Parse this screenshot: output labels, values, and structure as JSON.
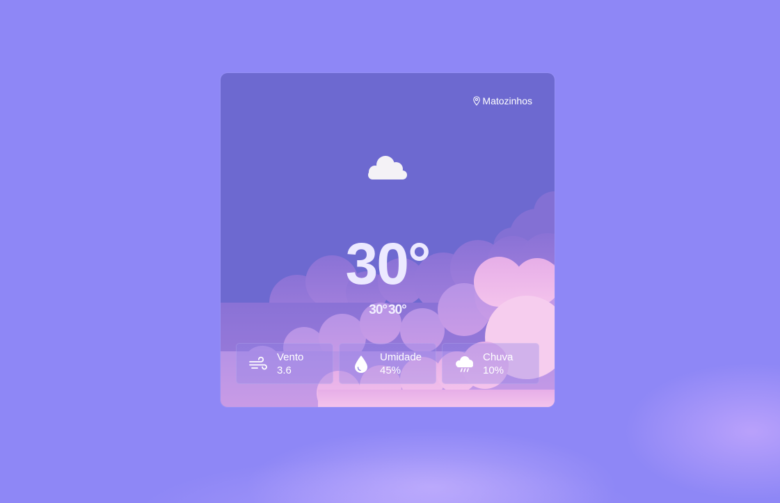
{
  "location": {
    "name": "Matozinhos",
    "icon": "map-pin-icon"
  },
  "current": {
    "icon": "cloud-icon",
    "temperature": "30°",
    "min": "30°",
    "max": "30°"
  },
  "stats": [
    {
      "icon": "wind-icon",
      "label": "Vento",
      "value": "3.6"
    },
    {
      "icon": "water-drop-icon",
      "label": "Umidade",
      "value": "45%"
    },
    {
      "icon": "rain-cloud-icon",
      "label": "Chuva",
      "value": "10%"
    }
  ],
  "colors": {
    "background": "#8e87f6",
    "card": "#6d69d0",
    "cloud_pink": "#f2bde8",
    "cloud_purple": "#9b85dd"
  }
}
